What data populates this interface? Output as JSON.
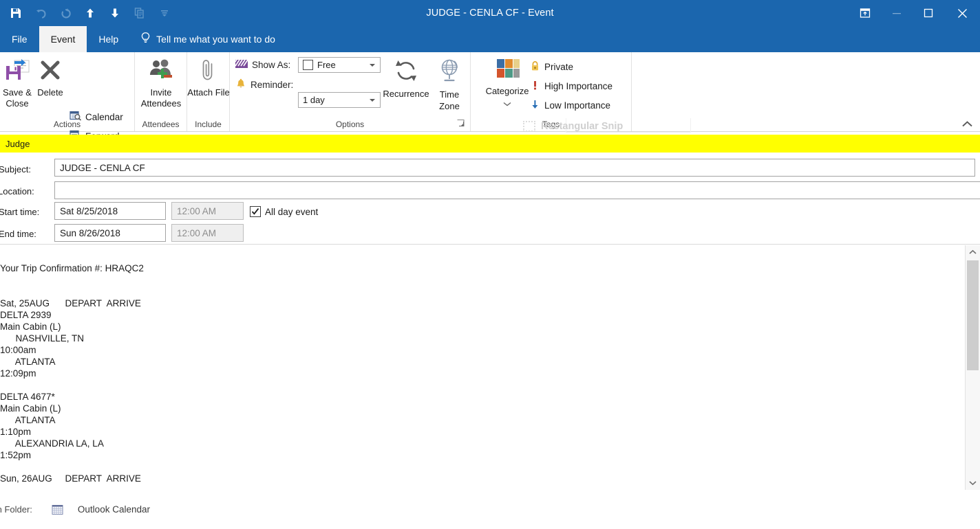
{
  "window": {
    "title": "JUDGE - CENLA CF  -  Event",
    "quick_access": [
      {
        "name": "save-icon",
        "label": "Save",
        "state": "enabled"
      },
      {
        "name": "undo-icon",
        "label": "Undo",
        "state": "disabled"
      },
      {
        "name": "redo-icon",
        "label": "Redo",
        "state": "disabled"
      },
      {
        "name": "previous-item-icon",
        "label": "Previous Item",
        "state": "enabled"
      },
      {
        "name": "next-item-icon",
        "label": "Next Item",
        "state": "enabled"
      },
      {
        "name": "copy-icon",
        "label": "Copy",
        "state": "disabled"
      },
      {
        "name": "customize-qat-icon",
        "label": "Customize Quick Access Toolbar",
        "state": "enabled"
      }
    ],
    "controls": {
      "restore_ribbon": "Ribbon Display Options",
      "minimize": "Minimize",
      "maximize": "Maximize",
      "close": "Close"
    }
  },
  "tabs": [
    {
      "label": "File",
      "active": false
    },
    {
      "label": "Event",
      "active": true
    },
    {
      "label": "Help",
      "active": false
    }
  ],
  "tellme": {
    "placeholder": "Tell me what you want to do",
    "icon": "lightbulb-icon"
  },
  "ribbon": {
    "collapse_label": "Collapse the Ribbon",
    "groups": [
      {
        "name": "Actions",
        "label": "Actions",
        "buttons": [
          {
            "label": "Save & Close",
            "icon": "save-close-icon"
          },
          {
            "label": "Delete",
            "icon": "delete-x-icon"
          },
          {
            "label": "Calendar",
            "icon": "calendar-search-icon"
          },
          {
            "label": "Forward",
            "icon": "forward-calendar-icon"
          }
        ]
      },
      {
        "name": "Attendees",
        "label": "Attendees",
        "buttons": [
          {
            "label": "Invite Attendees",
            "icon": "invite-attendees-icon"
          }
        ]
      },
      {
        "name": "Include",
        "label": "Include",
        "buttons": [
          {
            "label": "Attach File",
            "icon": "paperclip-icon"
          }
        ]
      },
      {
        "name": "Options",
        "label": "Options",
        "show_as": {
          "label": "Show As:",
          "value": "Free",
          "icon": "show-as-icon"
        },
        "reminder": {
          "label": "Reminder:",
          "value": "1 day",
          "icon": "bell-icon"
        },
        "buttons": [
          {
            "label": "Recurrence",
            "icon": "recurrence-icon"
          },
          {
            "label": "Time Zone",
            "icon": "globe-icon"
          }
        ],
        "dialog_launcher": "Options dialog launcher"
      },
      {
        "name": "Tags",
        "label": "Tags",
        "buttons": [
          {
            "label": "Categorize",
            "icon": "categorize-icon"
          },
          {
            "label": "Private",
            "icon": "lock-icon"
          },
          {
            "label": "High Importance",
            "icon": "exclamation-icon"
          },
          {
            "label": "Low Importance",
            "icon": "down-arrow-icon"
          }
        ]
      }
    ]
  },
  "snip_overlay": {
    "label": "Rectangular Snip",
    "icon": "rectangular-snip-icon"
  },
  "banner": {
    "text": "Judge",
    "color": "#ffff00"
  },
  "form": {
    "subject": {
      "label": "Subject:",
      "value": "JUDGE - CENLA CF"
    },
    "location": {
      "label": "Location:",
      "value": ""
    },
    "start_time": {
      "label": "Start time:",
      "date": "Sat 8/25/2018",
      "time": "12:00 AM"
    },
    "end_time": {
      "label": "End time:",
      "date": "Sun 8/26/2018",
      "time": "12:00 AM"
    },
    "all_day": {
      "label": "All day event",
      "checked": true
    }
  },
  "body": {
    "text": "Your Trip Confirmation #: HRAQC2\n\n\nSat, 25AUG      DEPART  ARRIVE\nDELTA 2939\nMain Cabin (L)\n      NASHVILLE, TN\n10:00am\n      ATLANTA\n12:09pm\n\nDELTA 4677*\nMain Cabin (L)\n      ATLANTA\n1:10pm\n      ALEXANDRIA LA, LA\n1:52pm\n\nSun, 26AUG     DEPART  ARRIVE"
  },
  "statusbar": {
    "label": "In Folder:",
    "folder": "Outlook Calendar",
    "icon": "calendar-grid-icon"
  }
}
